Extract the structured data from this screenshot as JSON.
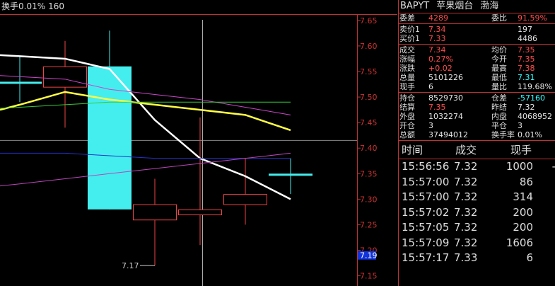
{
  "top_info": {
    "label": "换手0.01%",
    "value": "160"
  },
  "header": {
    "code": "BAPYT",
    "name": "苹果烟台",
    "exchange": "渤海"
  },
  "quote": {
    "weicha_label": "委差",
    "weicha": "4289",
    "weibi_label": "委比",
    "weibi": "91.59%",
    "sell1_label": "卖价1",
    "sell1": "7.34",
    "sell1_vol": "197",
    "buy1_label": "买价1",
    "buy1": "7.33",
    "buy1_vol": "4486",
    "rows": [
      {
        "l1": "成交",
        "v1": "7.34",
        "c1": "red",
        "l2": "均价",
        "v2": "7.35",
        "c2": "red"
      },
      {
        "l1": "涨幅",
        "v1": "0.27%",
        "c1": "red",
        "l2": "今开",
        "v2": "7.35",
        "c2": "red"
      },
      {
        "l1": "涨跌",
        "v1": "+0.02",
        "c1": "red",
        "l2": "最高",
        "v2": "7.38",
        "c2": "red"
      },
      {
        "l1": "总量",
        "v1": "5101226",
        "c1": "white",
        "l2": "最低",
        "v2": "7.31",
        "c2": "cyan"
      },
      {
        "l1": "现手",
        "v1": "6",
        "c1": "white",
        "l2": "量比",
        "v2": "119.68%",
        "c2": "white"
      }
    ],
    "rows2": [
      {
        "l1": "持仓",
        "v1": "8529730",
        "c1": "white",
        "l2": "仓差",
        "v2": "-57160",
        "c2": "cyan"
      },
      {
        "l1": "结算",
        "v1": "7.35",
        "c1": "red",
        "l2": "昨结",
        "v2": "7.32",
        "c2": "white"
      },
      {
        "l1": "外盘",
        "v1": "1032274",
        "c1": "white",
        "l2": "内盘",
        "v2": "4068952",
        "c2": "white"
      },
      {
        "l1": "开仓",
        "v1": "3",
        "c1": "white",
        "l2": "平仓",
        "v2": "3",
        "c2": "white"
      },
      {
        "l1": "总额",
        "v1": "37494012",
        "c1": "white",
        "l2": "换手率",
        "v2": "0.01%",
        "c2": "white"
      }
    ]
  },
  "ticks": {
    "headers": {
      "time": "时间",
      "price": "成交",
      "vol": "现手"
    },
    "rows": [
      {
        "time": "15:56:56",
        "price": "7.32",
        "vol": "1000",
        "flag": "-",
        "pc": "white",
        "vc": "white"
      },
      {
        "time": "15:57:00",
        "price": "7.32",
        "vol": "86",
        "flag": "",
        "pc": "white",
        "vc": "white"
      },
      {
        "time": "15:57:00",
        "price": "7.32",
        "vol": "314",
        "flag": "",
        "pc": "white",
        "vc": "white"
      },
      {
        "time": "15:57:02",
        "price": "7.32",
        "vol": "200",
        "flag": "",
        "pc": "white",
        "vc": "white"
      },
      {
        "time": "15:57:05",
        "price": "7.32",
        "vol": "200",
        "flag": "",
        "pc": "white",
        "vc": "white"
      },
      {
        "time": "15:57:09",
        "price": "7.32",
        "vol": "1606",
        "flag": "",
        "pc": "white",
        "vc": "white"
      },
      {
        "time": "15:57:17",
        "price": "7.33",
        "vol": "6",
        "flag": "",
        "pc": "red",
        "vc": "red"
      }
    ]
  },
  "chart_data": {
    "type": "candlestick",
    "ylim": [
      7.13,
      7.69
    ],
    "y_ticks": [
      "7.65",
      "7.60",
      "7.55",
      "7.50",
      "7.45",
      "7.40",
      "7.35",
      "7.30",
      "7.25",
      "7.20",
      "7.15"
    ],
    "current_price_label": "7.19",
    "low_marker": "7.17",
    "candles": [
      {
        "open": 7.53,
        "close": 7.53,
        "high": 7.58,
        "low": 7.49,
        "color": "cyan"
      },
      {
        "open": 7.52,
        "close": 7.56,
        "high": 7.61,
        "low": 7.44,
        "color": "red"
      },
      {
        "open": 7.56,
        "close": 7.28,
        "high": 7.63,
        "low": 7.28,
        "color": "cyan"
      },
      {
        "open": 7.26,
        "close": 7.29,
        "high": 7.34,
        "low": 7.17,
        "color": "red"
      },
      {
        "open": 7.28,
        "close": 7.27,
        "high": 7.46,
        "low": 7.21,
        "color": "red"
      },
      {
        "open": 7.29,
        "close": 7.31,
        "high": 7.38,
        "low": 7.25,
        "color": "red"
      },
      {
        "open": 7.35,
        "close": 7.35,
        "high": 7.38,
        "low": 7.31,
        "color": "cyan"
      }
    ],
    "ma_series": [
      {
        "color": "#ffffff",
        "width": 2.5,
        "values": [
          7.58,
          7.575,
          7.555,
          7.455,
          7.38,
          7.345,
          7.3
        ]
      },
      {
        "color": "#ffff44",
        "width": 2.5,
        "values": [
          7.485,
          7.51,
          7.495,
          7.485,
          7.475,
          7.465,
          7.435
        ]
      },
      {
        "color": "#cc44cc",
        "width": 1,
        "values": [
          7.54,
          7.535,
          7.515,
          7.505,
          7.495,
          7.48,
          7.465
        ]
      },
      {
        "color": "#33cc33",
        "width": 1,
        "values": [
          7.48,
          7.485,
          7.49,
          7.49,
          7.49,
          7.49,
          7.49
        ]
      },
      {
        "color": "#2233cc",
        "width": 1,
        "values": [
          7.39,
          7.39,
          7.385,
          7.38,
          7.38,
          7.38,
          7.38
        ]
      },
      {
        "color": "#bb44bb",
        "width": 1,
        "values": [
          7.33,
          7.34,
          7.35,
          7.36,
          7.37,
          7.38,
          7.39
        ]
      }
    ],
    "hline": 7.415
  }
}
